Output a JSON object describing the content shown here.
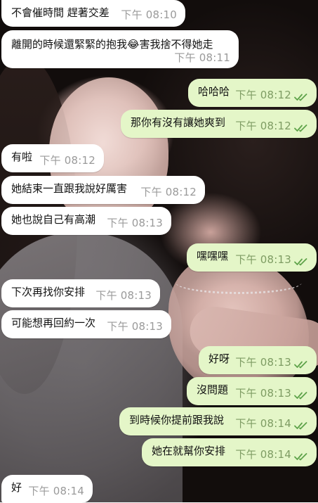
{
  "chat": {
    "messages": [
      {
        "dir": "in",
        "text": "不會催時間 趕著交差",
        "time": "下午 08:10"
      },
      {
        "dir": "in",
        "text": "離開的時候還緊緊的抱我😂害我捨不得她走",
        "time": "下午 08:11"
      },
      {
        "dir": "out",
        "text": "哈哈哈",
        "time": "下午 08:12",
        "status": "read"
      },
      {
        "dir": "out",
        "text": "那你有沒有讓她爽到",
        "time": "下午 08:12",
        "status": "read"
      },
      {
        "dir": "in",
        "text": "有啦",
        "time": "下午 08:12"
      },
      {
        "dir": "in",
        "text": "她結束一直跟我說好厲害",
        "time": "下午 08:12"
      },
      {
        "dir": "in",
        "text": "她也說自己有高潮",
        "time": "下午 08:13"
      },
      {
        "dir": "out",
        "text": "嘿嘿嘿",
        "time": "下午 08:13",
        "status": "read"
      },
      {
        "dir": "in",
        "text": "下次再找你安排",
        "time": "下午 08:13"
      },
      {
        "dir": "in",
        "text": "可能想再回約一次",
        "time": "下午 08:13"
      },
      {
        "dir": "out",
        "text": "好呀",
        "time": "下午 08:13",
        "status": "read"
      },
      {
        "dir": "out",
        "text": "沒問題",
        "time": "下午 08:13",
        "status": "read"
      },
      {
        "dir": "out",
        "text": "到時候你提前跟我說",
        "time": "下午 08:14",
        "status": "read"
      },
      {
        "dir": "out",
        "text": "她在就幫你安排",
        "time": "下午 08:14",
        "status": "read"
      },
      {
        "dir": "in",
        "text": "好",
        "time": "下午 08:14"
      }
    ]
  },
  "colors": {
    "incoming_bubble": "#ffffff",
    "outgoing_bubble": "#e4f6c8",
    "read_check": "#5fa34a"
  },
  "icons": {
    "read_receipt": "double-check-icon"
  }
}
